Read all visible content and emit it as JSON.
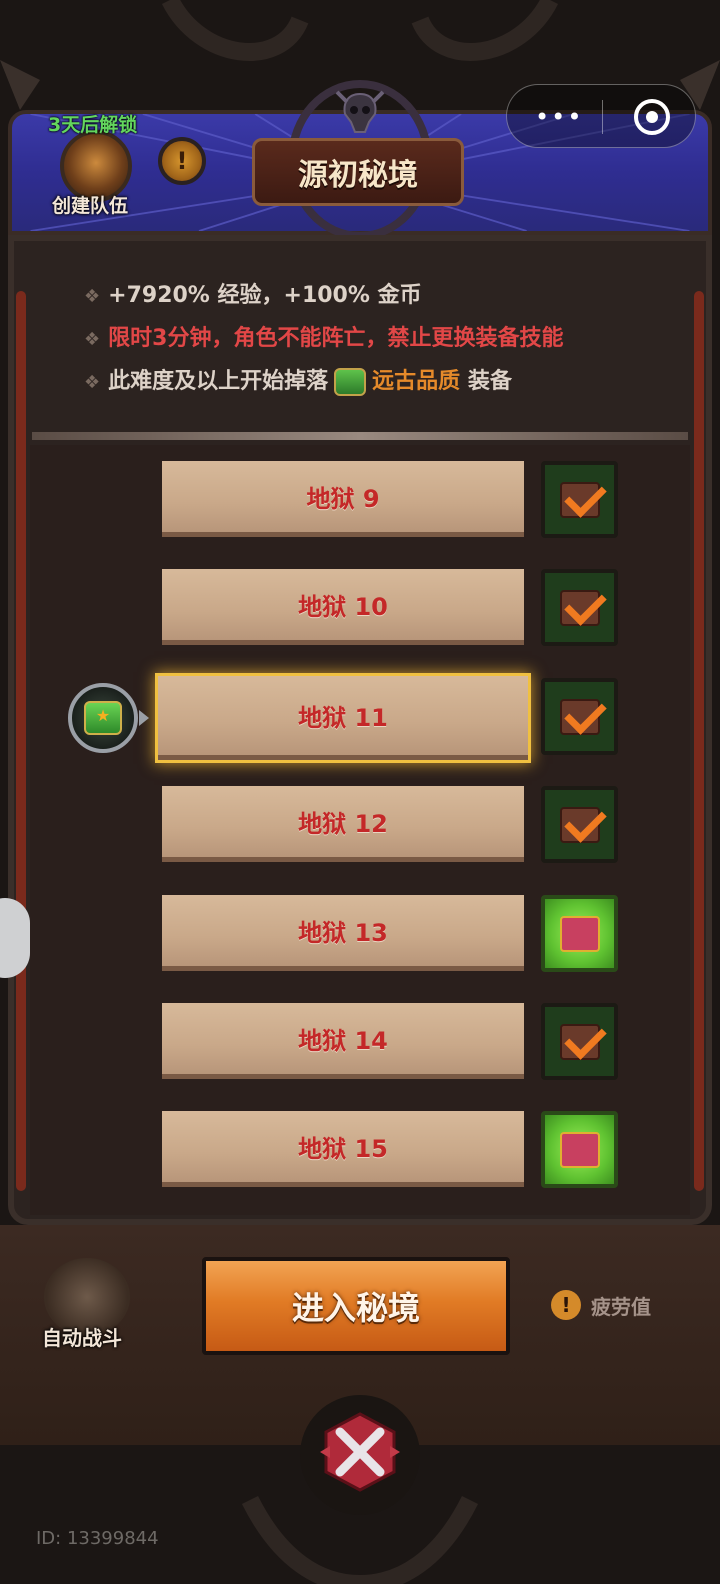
{
  "header": {
    "unlock_text": "3天后解锁",
    "team_label": "创建队伍",
    "warn_symbol": "!",
    "title": "源初秘境",
    "capsule_dots": "•••"
  },
  "info": {
    "line1": "+7920% 经验，+100% 金币",
    "line2": "限时3分钟，角色不能阵亡，禁止更换装备技能",
    "line3_prefix": "此难度及以上开始掉落",
    "line3_quality": "远古品质",
    "line3_suffix": "装备",
    "bullet": "❖"
  },
  "levels": [
    {
      "label": "地狱 9",
      "chest": "claimed"
    },
    {
      "label": "地狱 10",
      "chest": "claimed"
    },
    {
      "label": "地狱 11",
      "chest": "claimed",
      "selected": true
    },
    {
      "label": "地狱 12",
      "chest": "claimed"
    },
    {
      "label": "地狱 13",
      "chest": "available"
    },
    {
      "label": "地狱 14",
      "chest": "claimed"
    },
    {
      "label": "地狱 15",
      "chest": "available"
    }
  ],
  "bottom": {
    "auto_label": "自动战斗",
    "enter_label": "进入秘境",
    "fatigue_symbol": "!",
    "fatigue_label": "疲劳值",
    "id_text": "ID: 13399844"
  },
  "colors": {
    "accent_orange": "#e17b25",
    "red_text": "#e24747",
    "quality_orange": "#e58a2a",
    "level_text": "#c42828"
  }
}
